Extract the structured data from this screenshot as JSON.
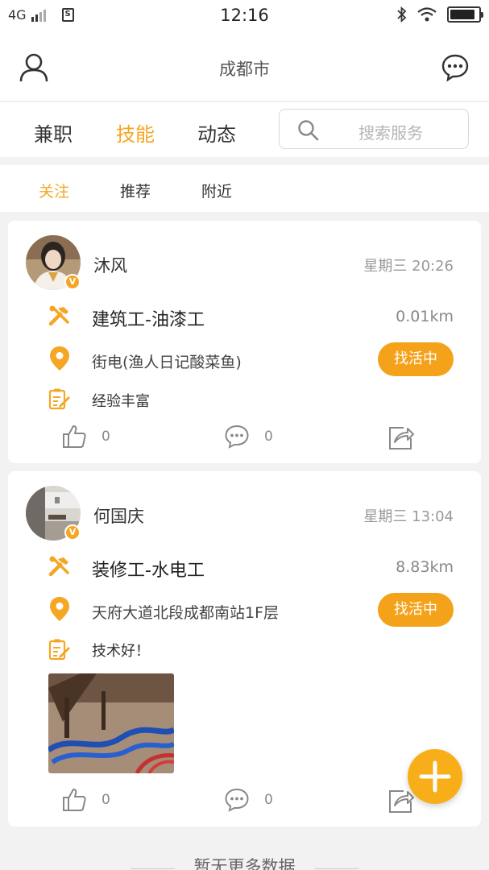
{
  "status": {
    "network": "4G",
    "time": "12:16"
  },
  "header": {
    "title": "成都市"
  },
  "tabs": [
    {
      "label": "兼职",
      "active": false
    },
    {
      "label": "技能",
      "active": true
    },
    {
      "label": "动态",
      "active": false
    }
  ],
  "search": {
    "placeholder": "搜索服务"
  },
  "subtabs": [
    {
      "label": "关注",
      "active": true
    },
    {
      "label": "推荐",
      "active": false
    },
    {
      "label": "附近",
      "active": false
    }
  ],
  "posts": [
    {
      "name": "沐风",
      "time": "星期三 20:26",
      "verified_badge": "V",
      "skill": "建筑工-油漆工",
      "distance": "0.01km",
      "address": "街电(渔人日记酸菜鱼)",
      "status": "找活中",
      "description": "经验丰富",
      "likes": "0",
      "comments": "0"
    },
    {
      "name": "何国庆",
      "time": "星期三 13:04",
      "verified_badge": "V",
      "skill": "装修工-水电工",
      "distance": "8.83km",
      "address": "天府大道北段成都南站1F层",
      "status": "找活中",
      "description": "技术好！",
      "likes": "0",
      "comments": "0"
    }
  ],
  "footer": {
    "text": "暂无更多数据"
  },
  "colors": {
    "accent": "#f5a623",
    "pill": "#f5a21b",
    "fab": "#f7ae18"
  },
  "icons": [
    "user-icon",
    "chat-bubble-icon",
    "search-icon",
    "tools-icon",
    "location-pin-icon",
    "note-edit-icon",
    "thumbs-up-icon",
    "comment-icon",
    "share-icon",
    "plus-icon"
  ]
}
